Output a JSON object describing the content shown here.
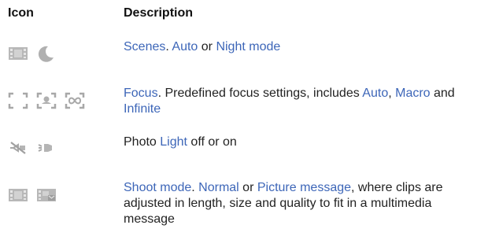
{
  "headers": {
    "icon": "Icon",
    "description": "Description"
  },
  "rows": [
    {
      "icons": [
        "film-scene-icon",
        "moon-night-icon"
      ],
      "parts": [
        {
          "text": "Scenes",
          "hl": true
        },
        {
          "text": ". ",
          "hl": false
        },
        {
          "text": "Auto",
          "hl": true
        },
        {
          "text": " or ",
          "hl": false
        },
        {
          "text": "Night mode",
          "hl": true
        }
      ]
    },
    {
      "icons": [
        "focus-auto-icon",
        "focus-macro-icon",
        "focus-infinite-icon"
      ],
      "parts": [
        {
          "text": "Focus",
          "hl": true
        },
        {
          "text": ". Predefined focus settings, includes ",
          "hl": false
        },
        {
          "text": "Auto",
          "hl": true
        },
        {
          "text": ", ",
          "hl": false
        },
        {
          "text": "Macro",
          "hl": true
        },
        {
          "text": " and ",
          "hl": false
        },
        {
          "text": "Infinite",
          "hl": true
        }
      ]
    },
    {
      "icons": [
        "light-off-icon",
        "light-on-icon"
      ],
      "parts": [
        {
          "text": "Photo ",
          "hl": false
        },
        {
          "text": "Light",
          "hl": true
        },
        {
          "text": " off or on",
          "hl": false
        }
      ]
    },
    {
      "icons": [
        "shoot-normal-icon",
        "shoot-picture-message-icon"
      ],
      "parts": [
        {
          "text": "Shoot mode",
          "hl": true
        },
        {
          "text": ". ",
          "hl": false
        },
        {
          "text": "Normal",
          "hl": true
        },
        {
          "text": " or ",
          "hl": false
        },
        {
          "text": "Picture message",
          "hl": true
        },
        {
          "text": ", where clips are adjusted in length, size and quality to fit in a multimedia message",
          "hl": false
        }
      ]
    }
  ],
  "colors": {
    "highlight": "#3d66b8",
    "text": "#222222",
    "icon": "#a9a9a9"
  }
}
